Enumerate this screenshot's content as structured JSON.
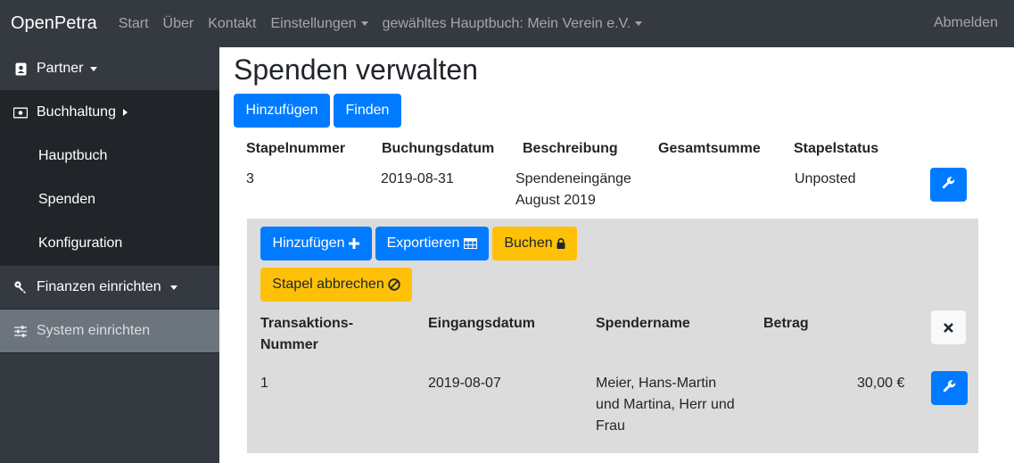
{
  "navbar": {
    "brand": "OpenPetra",
    "links": [
      "Start",
      "Über",
      "Kontakt"
    ],
    "settings": "Einstellungen",
    "ledger": "gewähltes Hauptbuch: Mein Verein e.V.",
    "logout": "Abmelden"
  },
  "sidebar": {
    "partner": "Partner",
    "accounting": "Buchhaltung",
    "sub": [
      "Hauptbuch",
      "Spenden",
      "Konfiguration"
    ],
    "finance": "Finanzen einrichten",
    "system": "System einrichten"
  },
  "page": {
    "title": "Spenden verwalten",
    "add": "Hinzufügen",
    "find": "Finden"
  },
  "batches": {
    "headers": [
      "Stapelnummer",
      "Buchungsdatum",
      "Beschreibung",
      "Gesamtsumme",
      "Stapelstatus"
    ],
    "row": {
      "number": "3",
      "date": "2019-08-31",
      "description_line1": "Spendeneingänge",
      "description_line2": "August 2019",
      "total": "",
      "status": "Unposted"
    }
  },
  "detail": {
    "add": "Hinzufügen",
    "export": "Exportieren",
    "post": "Buchen",
    "cancel": "Stapel abbrechen",
    "headers": {
      "trans_line1": "Transaktions-",
      "trans_line2": "Nummer",
      "date": "Eingangsdatum",
      "donor": "Spendername",
      "amount": "Betrag"
    },
    "row": {
      "number": "1",
      "date": "2019-08-07",
      "donor_line1": "Meier, Hans-Martin",
      "donor_line2": "und Martina, Herr und",
      "donor_line3": "Frau",
      "amount": "30,00 €"
    }
  },
  "colors": {
    "navbar": "#343a40",
    "primary": "#007bff",
    "warning": "#ffc107",
    "detail_bg": "#dcdcdc"
  }
}
